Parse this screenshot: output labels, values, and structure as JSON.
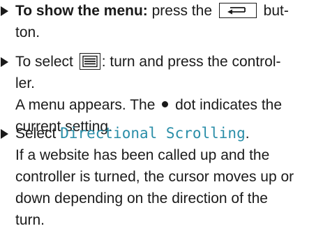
{
  "steps": [
    {
      "lines": {
        "l1_bold": "To show the menu:",
        "l1_pre": " press the",
        "l1_post": " but-",
        "l2": "ton."
      },
      "key_icon": "back-button-icon"
    },
    {
      "lines": {
        "l1_pre": "To select",
        "l1_post": ": turn and press the control-",
        "l2": "ler.",
        "l3": "A menu appears. The",
        "l3_post": " dot indicates the",
        "l4": "current setting."
      },
      "menu_icon": "menu-list-icon",
      "dot_icon": "bullet-dot-icon"
    },
    {
      "lines": {
        "l1_pre": "Select ",
        "l1_mono": "Directional Scrolling",
        "l1_post": ".",
        "l2": "If a website has been called up and the",
        "l3": "controller is turned, the cursor moves up or",
        "l4": "down depending on the direction of the",
        "l5": "turn."
      }
    }
  ]
}
